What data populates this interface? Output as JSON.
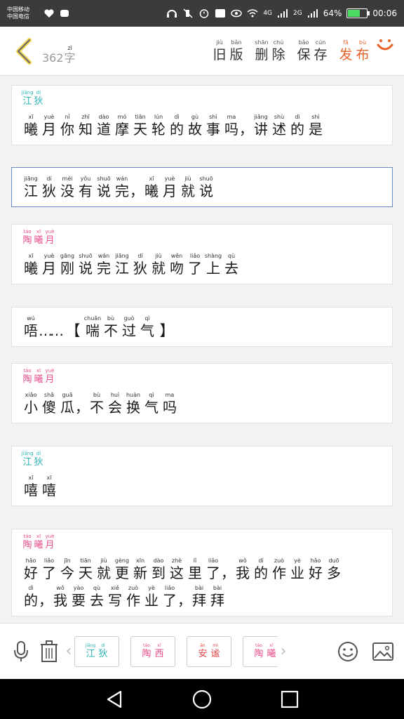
{
  "status_bar": {
    "carrier_1": "中国移动",
    "carrier_2": "中国电信",
    "net_1": "4G",
    "net_2": "2G",
    "battery": "64%",
    "time": "00:06"
  },
  "toolbar": {
    "word_count": {
      "num": "362",
      "char": "字",
      "py": "zì"
    },
    "actions": [
      {
        "chars": [
          "旧",
          "版"
        ],
        "py": [
          "jiù",
          "bǎn"
        ],
        "color": "default"
      },
      {
        "chars": [
          "删",
          "除"
        ],
        "py": [
          "shān",
          "chú"
        ],
        "color": "default"
      },
      {
        "chars": [
          "保",
          "存"
        ],
        "py": [
          "bǎo",
          "cún"
        ],
        "color": "default"
      },
      {
        "chars": [
          "发",
          "布"
        ],
        "py": [
          "fā",
          "bù"
        ],
        "color": "red"
      }
    ]
  },
  "messages": [
    {
      "speaker": {
        "chars": [
          "江",
          "狄"
        ],
        "py": [
          "jiāng",
          "dí"
        ],
        "color": "teal"
      },
      "lines": [
        [
          [
            "曦",
            "xī"
          ],
          [
            "月",
            "yuè"
          ],
          [
            "你",
            "nǐ"
          ],
          [
            "知",
            "zhī"
          ],
          [
            "道",
            "dào"
          ],
          [
            "摩",
            "mó"
          ],
          [
            "天",
            "tiān"
          ],
          [
            "轮",
            "lún"
          ],
          [
            "的",
            "dì"
          ],
          [
            "故",
            "gù"
          ],
          [
            "事",
            "shì"
          ],
          [
            "吗",
            "ma"
          ],
          [
            "，",
            ""
          ],
          [
            "讲",
            "jiǎng"
          ],
          [
            "述",
            "shù"
          ],
          [
            "的",
            "dì"
          ],
          [
            "是",
            "shì"
          ]
        ]
      ]
    },
    {
      "speaker": null,
      "selected": true,
      "lines": [
        [
          [
            "江",
            "jiāng"
          ],
          [
            "狄",
            "dí"
          ],
          [
            "没",
            "méi"
          ],
          [
            "有",
            "yǒu"
          ],
          [
            "说",
            "shuō"
          ],
          [
            "完",
            "wán"
          ],
          [
            "，",
            ""
          ],
          [
            "曦",
            "xī"
          ],
          [
            "月",
            "yuè"
          ],
          [
            "就",
            "jiù"
          ],
          [
            "说",
            "shuō"
          ]
        ]
      ]
    },
    {
      "speaker": {
        "chars": [
          "陶",
          "曦",
          "月"
        ],
        "py": [
          "táo",
          "xī",
          "yuè"
        ],
        "color": "pink"
      },
      "lines": [
        [
          [
            "曦",
            "xī"
          ],
          [
            "月",
            "yuè"
          ],
          [
            "刚",
            "gāng"
          ],
          [
            "说",
            "shuō"
          ],
          [
            "完",
            "wán"
          ],
          [
            "江",
            "jiāng"
          ],
          [
            "狄",
            "dí"
          ],
          [
            "就",
            "jiù"
          ],
          [
            "吻",
            "wěn"
          ],
          [
            "了",
            "liǎo"
          ],
          [
            "上",
            "shàng"
          ],
          [
            "去",
            "qù"
          ]
        ]
      ]
    },
    {
      "speaker": null,
      "lines": [
        [
          [
            "唔",
            "wú"
          ],
          [
            "…",
            ""
          ],
          [
            "…",
            ""
          ],
          [
            "【",
            ""
          ],
          [
            "喘",
            "chuǎn"
          ],
          [
            "不",
            "bù"
          ],
          [
            "过",
            "guò"
          ],
          [
            "气",
            "qì"
          ],
          [
            "】",
            ""
          ]
        ]
      ]
    },
    {
      "speaker": {
        "chars": [
          "陶",
          "曦",
          "月"
        ],
        "py": [
          "táo",
          "xī",
          "yuè"
        ],
        "color": "pink"
      },
      "lines": [
        [
          [
            "小",
            "xiǎo"
          ],
          [
            "傻",
            "shǎ"
          ],
          [
            "瓜",
            "guā"
          ],
          [
            "，",
            ""
          ],
          [
            "不",
            "bù"
          ],
          [
            "会",
            "huì"
          ],
          [
            "换",
            "huàn"
          ],
          [
            "气",
            "qì"
          ],
          [
            "吗",
            "ma"
          ]
        ]
      ]
    },
    {
      "speaker": {
        "chars": [
          "江",
          "狄"
        ],
        "py": [
          "jiāng",
          "dí"
        ],
        "color": "teal"
      },
      "lines": [
        [
          [
            "嘻",
            "xī"
          ],
          [
            "嘻",
            "xī"
          ]
        ]
      ]
    },
    {
      "speaker": {
        "chars": [
          "陶",
          "曦",
          "月"
        ],
        "py": [
          "táo",
          "xī",
          "yuè"
        ],
        "color": "pink"
      },
      "lines": [
        [
          [
            "好",
            "hǎo"
          ],
          [
            "了",
            "liǎo"
          ],
          [
            "今",
            "jīn"
          ],
          [
            "天",
            "tiān"
          ],
          [
            "就",
            "jiù"
          ],
          [
            "更",
            "gèng"
          ],
          [
            "新",
            "xīn"
          ],
          [
            "到",
            "dào"
          ],
          [
            "这",
            "zhè"
          ],
          [
            "里",
            "lǐ"
          ],
          [
            "了",
            "liǎo"
          ],
          [
            "，",
            ""
          ],
          [
            "我",
            "wǒ"
          ],
          [
            "的",
            "dí"
          ],
          [
            "作",
            "zuò"
          ],
          [
            "业",
            "yè"
          ],
          [
            "好",
            "hǎo"
          ],
          [
            "多",
            "duō"
          ]
        ],
        [
          [
            "的",
            "dì"
          ],
          [
            "，",
            ""
          ],
          [
            "我",
            "wǒ"
          ],
          [
            "要",
            "yào"
          ],
          [
            "去",
            "qù"
          ],
          [
            "写",
            "xiě"
          ],
          [
            "作",
            "zuò"
          ],
          [
            "业",
            "yè"
          ],
          [
            "了",
            "liǎo"
          ],
          [
            "，",
            ""
          ],
          [
            "拜",
            "bài"
          ],
          [
            "拜",
            "bài"
          ]
        ]
      ]
    }
  ],
  "bottom_bar": {
    "chips": [
      {
        "chars": [
          "江",
          "狄"
        ],
        "py": [
          "jiāng",
          "dí"
        ],
        "color": "teal"
      },
      {
        "chars": [
          "陶",
          "西"
        ],
        "py": [
          "táo",
          "xī"
        ],
        "color": "pink"
      },
      {
        "chars": [
          "安",
          "谧"
        ],
        "py": [
          "ān",
          "mì"
        ],
        "color": "red"
      },
      {
        "chars": [
          "陶",
          "曦"
        ],
        "py": [
          "táo",
          "xī"
        ],
        "color": "pink"
      }
    ]
  },
  "icons": [
    "back-chevron-icon",
    "smile-icon",
    "microphone-icon",
    "trash-icon",
    "chevron-left-icon",
    "chevron-right-icon",
    "emoji-icon",
    "image-icon",
    "nav-back-icon",
    "nav-home-icon",
    "nav-recent-icon"
  ]
}
